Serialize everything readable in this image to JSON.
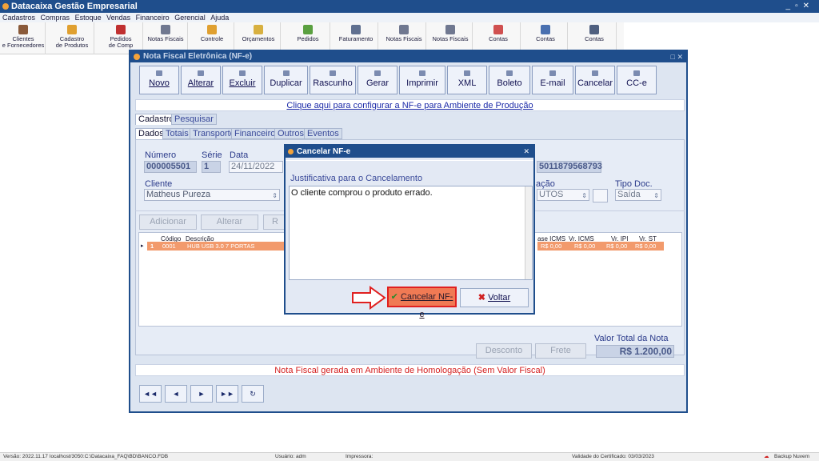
{
  "app": {
    "title": "Datacaixa Gestão Empresarial"
  },
  "menu": [
    "Cadastros",
    "Compras",
    "Estoque",
    "Vendas",
    "Financeiro",
    "Gerencial",
    "Ajuda"
  ],
  "toolbar": [
    {
      "label": "Clientes\ne Fornecedores",
      "color": "#8a5a3a"
    },
    {
      "label": "Cadastro\nde Produtos",
      "color": "#e0a030"
    },
    {
      "label": "Pedidos\nde Comp",
      "color": "#c03030"
    },
    {
      "label": "Notas Fiscais",
      "color": "#707890"
    },
    {
      "label": "Controle",
      "color": "#e0a030"
    },
    {
      "label": "Orçamentos",
      "color": "#d8b040"
    },
    {
      "label": "Pedidos",
      "color": "#5aa040"
    },
    {
      "label": "Faturamento",
      "color": "#607090"
    },
    {
      "label": "Notas Fiscais",
      "color": "#707890"
    },
    {
      "label": "Notas Fiscais",
      "color": "#707890"
    },
    {
      "label": "Contas",
      "color": "#d05050"
    },
    {
      "label": "Contas",
      "color": "#4a70b0"
    },
    {
      "label": "Contas",
      "color": "#506080"
    }
  ],
  "nf": {
    "title": "Nota Fiscal Eletrônica (NF-e)",
    "actions": {
      "novo": "Novo",
      "alterar": "Alterar",
      "excluir": "Excluir",
      "duplicar": "Duplicar",
      "rascunho": "Rascunho",
      "gerar": "Gerar",
      "imprimir": "Imprimir",
      "xml": "XML",
      "boleto": "Boleto",
      "email": "E-mail",
      "cancelar": "Cancelar",
      "cce": "CC-e"
    },
    "config_link": "Clique aqui para configurar a NF-e para Ambiente de Produção",
    "tabs_top": [
      "Cadastro",
      "Pesquisar"
    ],
    "tabs_sub": [
      "Dados",
      "Totais",
      "Transporte",
      "Financeiro",
      "Outros",
      "Eventos"
    ],
    "fields": {
      "numero_label": "Número",
      "numero": "000005501",
      "serie_label": "Série",
      "serie": "1",
      "data_label": "Data",
      "data": "24/11/2022",
      "chave_partial": "5011879568793",
      "cliente_label": "Cliente",
      "cliente": "Matheus Pureza",
      "operacao_label_partial": "ação",
      "operacao_partial": "UTOS",
      "tipo_doc_label": "Tipo Doc.",
      "tipo_doc": "Saída"
    },
    "items_buttons": {
      "adicionar": "Adicionar",
      "alterar": "Alterar",
      "remover_partial": "R"
    },
    "grid": {
      "headers_left": [
        "Código",
        "Descrição"
      ],
      "headers_right": [
        "ase ICMS",
        "Vr. ICMS",
        "Vr. IPI",
        "Vr. ST"
      ],
      "row": {
        "n": "1",
        "codigo": "0001",
        "descricao": "HUB USB 3.0 7 PORTAS",
        "base_icms": "R$ 0,00",
        "vr_icms": "R$ 0,00",
        "vr_ipi": "R$ 0,00",
        "vr_st": "R$ 0,00"
      }
    },
    "desconto": "Desconto",
    "frete": "Frete",
    "total_label": "Valor Total da Nota",
    "total": "R$ 1.200,00",
    "homologacao": "Nota Fiscal gerada em Ambiente de Homologação (Sem Valor Fiscal)",
    "nav": [
      "◄◄",
      "◄",
      "►",
      "►►",
      "↻"
    ]
  },
  "dialog": {
    "title": "Cancelar NF-e",
    "label": "Justificativa para o Cancelamento",
    "text": "O cliente comprou o produto errado.",
    "confirm": "Cancelar NF-e",
    "back": "Voltar"
  },
  "status": {
    "version": "Versão: 2022.11.17",
    "db": "localhost/3050:C:\\Datacaixa_FAQ\\BD\\BANCO.FDB",
    "user": "Usuário: adm",
    "printer": "Impressora:",
    "cert": "Validade do Certificado: 03/03/2023",
    "backup": "Backup Nuvem"
  },
  "colors": {
    "accent": "#1f4e8c",
    "danger": "#e02020",
    "confirm_button": "#f07a54"
  }
}
